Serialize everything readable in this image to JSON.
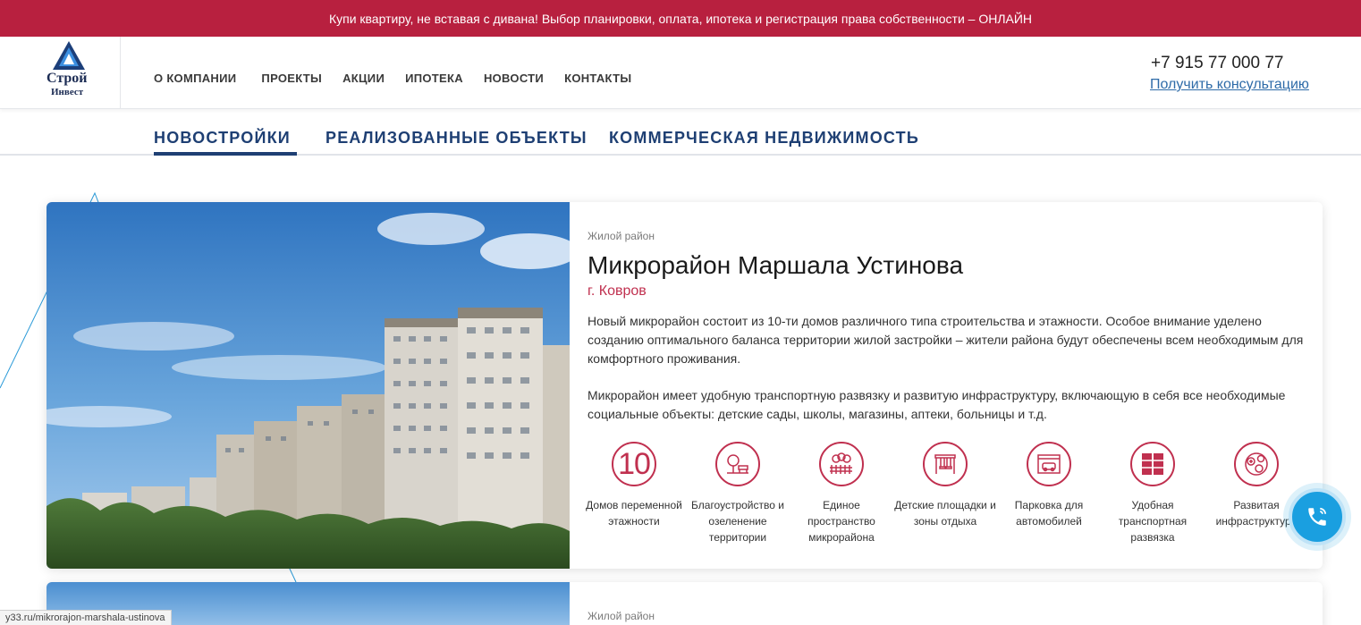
{
  "promo": {
    "text": "Купи квартиру, не вставая с дивана! Выбор планировки, оплата, ипотека и регистрация права собственности – ОНЛАЙН"
  },
  "logo": {
    "line1": "Строй",
    "line2": "Инвест"
  },
  "nav": {
    "items": [
      {
        "label": "О КОМПАНИИ"
      },
      {
        "label": "ПРОЕКТЫ"
      },
      {
        "label": "АКЦИИ"
      },
      {
        "label": "ИПОТЕКА"
      },
      {
        "label": "НОВОСТИ"
      },
      {
        "label": "КОНТАКТЫ"
      }
    ]
  },
  "contact": {
    "phone": "+7 915 77 000 77",
    "consult": "Получить консультацию"
  },
  "tabs": [
    {
      "label": "НОВОСТРОЙКИ",
      "active": true
    },
    {
      "label": "РЕАЛИЗОВАННЫЕ ОБЪЕКТЫ",
      "active": false
    },
    {
      "label": "КОММЕРЧЕСКАЯ НЕДВИЖИМОСТЬ",
      "active": false
    }
  ],
  "project": {
    "kind": "Жилой район",
    "title": "Микрорайон Маршала Устинова",
    "city": "г. Ковров",
    "desc1": "Новый микрорайон состоит из 10-ти домов различного типа строительства и этажности. Особое внимание уделено созданию оптимального баланса территории жилой застройки – жители района будут обеспечены всем необходимым для комфортного проживания.",
    "desc2": "Микрорайон имеет удобную транспортную развязку и развитую инфраструктуру, включающую в себя все необходимые социальные объекты: детские сады, школы, магазины, аптеки, больницы и т.д.",
    "features": [
      {
        "icon": "number-10",
        "number": "10",
        "label": "Домов переменной этажности"
      },
      {
        "icon": "tree-bench-icon",
        "label": "Благоустройство и озеленение территории"
      },
      {
        "icon": "fence-trees-icon",
        "label": "Единое пространство микрорайона"
      },
      {
        "icon": "swing-icon",
        "label": "Детские площадки и зоны отдыха"
      },
      {
        "icon": "garage-car-icon",
        "label": "Парковка для автомобилей"
      },
      {
        "icon": "road-icon",
        "label": "Удобная транспортная развязка"
      },
      {
        "icon": "infrastructure-icon",
        "label": "Развитая инфраструктура"
      }
    ]
  },
  "project2": {
    "kind": "Жилой район"
  },
  "statusbar": {
    "url": "y33.ru/mikrorajon-marshala-ustinova"
  },
  "colors": {
    "promo": "#b8203f",
    "accent": "#c0304f",
    "navy": "#1e3f73",
    "call": "#1a9fe0"
  }
}
